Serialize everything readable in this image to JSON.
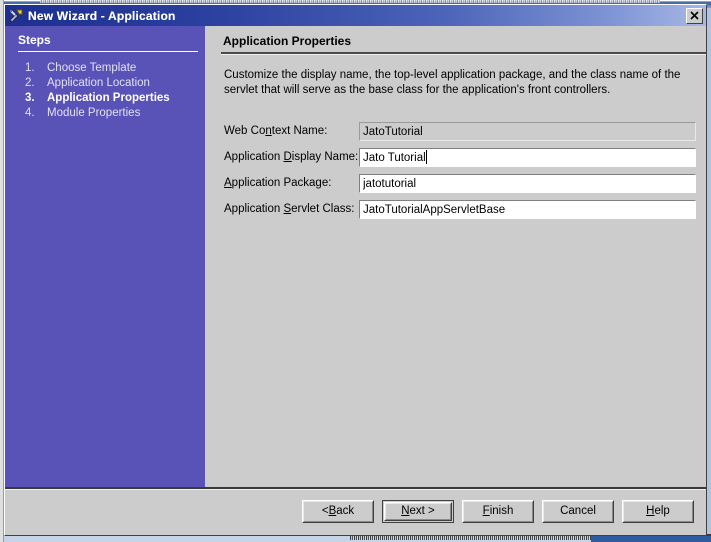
{
  "window": {
    "title": "New Wizard - Application",
    "icon": "tools-icon",
    "close_label": "✕"
  },
  "sidebar": {
    "heading": "Steps",
    "accent_color": "#5953b8",
    "steps": [
      {
        "number": "1.",
        "label": "Choose Template",
        "current": false
      },
      {
        "number": "2.",
        "label": "Application Location",
        "current": false
      },
      {
        "number": "3.",
        "label": "Application Properties",
        "current": true
      },
      {
        "number": "4.",
        "label": "Module Properties",
        "current": false
      }
    ]
  },
  "content": {
    "title": "Application Properties",
    "description": "Customize the display name, the top-level application package, and the class name of the servlet that will serve as the base class for the application's front controllers.",
    "fields": [
      {
        "label_before": "Web Co",
        "label_mnemonic": "n",
        "label_after": "text Name:",
        "value": "JatoTutorial",
        "disabled": true,
        "focused": false
      },
      {
        "label_before": "Application ",
        "label_mnemonic": "D",
        "label_after": "isplay Name:",
        "value": "Jato Tutorial",
        "disabled": false,
        "focused": true
      },
      {
        "label_before": "",
        "label_mnemonic": "A",
        "label_after": "pplication Package:",
        "value": "jatotutorial",
        "disabled": false,
        "focused": false
      },
      {
        "label_before": "Application ",
        "label_mnemonic": "S",
        "label_after": "ervlet Class:",
        "value": "JatoTutorialAppServletBase",
        "disabled": false,
        "focused": false
      }
    ]
  },
  "footer": {
    "buttons": [
      {
        "label": "< Back",
        "default": false
      },
      {
        "label": "Next >",
        "default": true
      },
      {
        "label": "Finish",
        "default": false
      },
      {
        "label": "Cancel",
        "default": false
      },
      {
        "label": "Help",
        "default": false
      }
    ]
  }
}
